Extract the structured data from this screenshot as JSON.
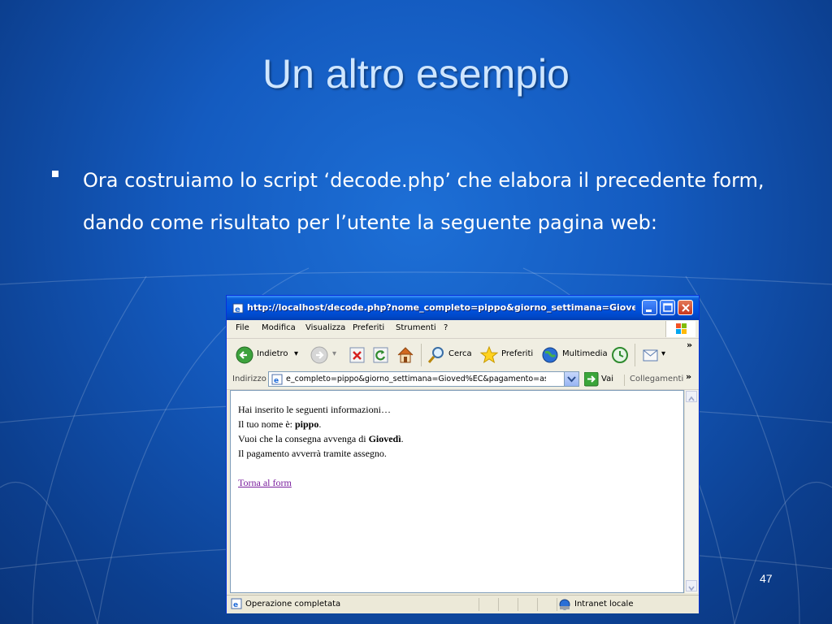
{
  "slide": {
    "title": "Un altro esempio",
    "bullet": "Ora costruiamo lo script ‘decode.php’ che elabora il precedente form, dando come risultato per l’utente la seguente pagina web:",
    "page_number": "47"
  },
  "browser": {
    "title": "http://localhost/decode.php?nome_completo=pippo&giorno_settimana=Giove...",
    "menu": [
      "File",
      "Modifica",
      "Visualizza",
      "Preferiti",
      "Strumenti",
      "?"
    ],
    "toolbar": {
      "back": "Indietro",
      "search": "Cerca",
      "favorites": "Preferiti",
      "media": "Multimedia"
    },
    "address": {
      "label": "Indirizzo",
      "value": "e_completo=pippo&giorno_settimana=Gioved%EC&pagamento=assegno",
      "go": "Vai",
      "links": "Collegamenti"
    },
    "content": {
      "line1": "Hai inserito le seguenti informazioni…",
      "line2_prefix": "Il tuo nome è: ",
      "line2_bold": "pippo",
      "line2_suffix": ".",
      "line3_prefix": "Vuoi che la consegna avvenga di ",
      "line3_bold": "Giovedì",
      "line3_suffix": ".",
      "line4": "Il pagamento avverrà tramite assegno.",
      "link": "Torna al form"
    },
    "status": {
      "left": "Operazione completata",
      "zone": "Intranet locale"
    }
  },
  "colors": {
    "background": "#145bc0",
    "title_text": "#cfe6ff",
    "titlebar": "#0054e3",
    "visited_link": "#7a1f9e"
  }
}
